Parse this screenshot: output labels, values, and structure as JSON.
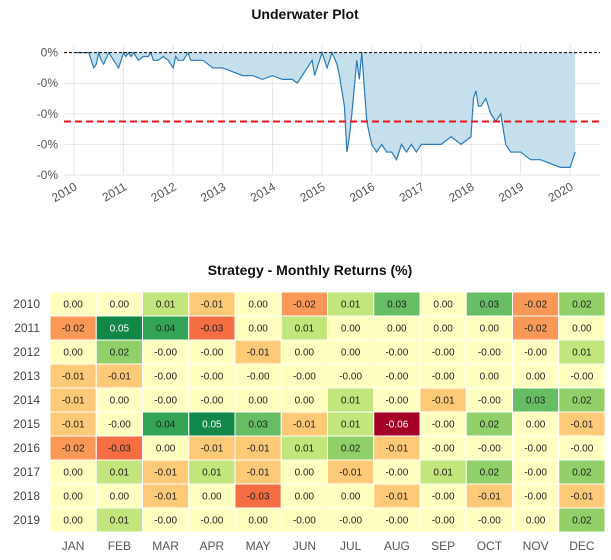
{
  "chart_data": [
    {
      "type": "area",
      "title": "Underwater Plot",
      "ytick_labels": [
        "0%",
        "-0%",
        "-0%",
        "-0%",
        "-0%"
      ],
      "xtick_labels": [
        "2010",
        "2011",
        "2012",
        "2013",
        "2014",
        "2015",
        "2016",
        "2017",
        "2018",
        "2019",
        "2020"
      ],
      "xlim": [
        2009.8,
        2020.6
      ],
      "ylim": [
        -0.0016,
        0.0001
      ],
      "reference_lines": [
        {
          "value": 0,
          "style": "dashed",
          "color": "#000000"
        },
        {
          "value": -0.0009,
          "style": "dashed",
          "color": "#e8141b"
        }
      ],
      "colors": {
        "fill": "#c6dfec",
        "line": "#2b7bba"
      },
      "grid": true,
      "series": [
        {
          "x": [
            2010.05,
            2010.3,
            2010.35,
            2010.4,
            2010.45,
            2010.5,
            2010.55,
            2010.6,
            2010.7,
            2010.8,
            2010.9,
            2010.95,
            2011.0,
            2011.05,
            2011.1,
            2011.15,
            2011.2,
            2011.3,
            2011.4,
            2011.5,
            2011.55,
            2011.6,
            2011.7,
            2011.8,
            2011.9,
            2012.0,
            2012.05,
            2012.1,
            2012.2,
            2012.3,
            2012.35,
            2012.45,
            2012.6,
            2012.8,
            2013.0,
            2013.2,
            2013.4,
            2013.6,
            2013.8,
            2014.0,
            2014.2,
            2014.4,
            2014.5,
            2014.6,
            2014.7,
            2014.8,
            2014.85,
            2014.9,
            2015.0,
            2015.1,
            2015.2,
            2015.3,
            2015.35,
            2015.4,
            2015.45,
            2015.5,
            2015.55,
            2015.6,
            2015.7,
            2015.75,
            2015.8,
            2015.9,
            2016.0,
            2016.1,
            2016.2,
            2016.3,
            2016.4,
            2016.5,
            2016.6,
            2016.7,
            2016.8,
            2016.9,
            2017.0,
            2017.2,
            2017.4,
            2017.6,
            2017.8,
            2018.0,
            2018.05,
            2018.1,
            2018.15,
            2018.2,
            2018.3,
            2018.4,
            2018.5,
            2018.6,
            2018.7,
            2018.8,
            2018.9,
            2019.0,
            2019.2,
            2019.4,
            2019.6,
            2019.8,
            2020.0,
            2020.05,
            2020.1
          ],
          "y": [
            0,
            0,
            -0.0001,
            -0.0002,
            -0.00015,
            0,
            -0.0001,
            -0.00015,
            0,
            -0.0001,
            -0.0002,
            -0.0001,
            0,
            -5e-05,
            0,
            -5e-05,
            0,
            -0.0001,
            -5e-05,
            -5e-05,
            0,
            -0.0001,
            -0.0001,
            -5e-05,
            -0.0001,
            -0.0002,
            -5e-05,
            -0.0001,
            -0.0001,
            0,
            -0.0001,
            -0.0001,
            -0.0001,
            -0.0002,
            -0.0002,
            -0.00025,
            -0.0003,
            -0.0003,
            -0.00035,
            -0.0003,
            -0.00035,
            -0.00035,
            -0.0004,
            -0.0003,
            -0.0002,
            -0.0001,
            -0.0003,
            -0.0002,
            0,
            -0.0002,
            0,
            -0.00015,
            -0.0003,
            -0.0005,
            -0.0007,
            -0.0013,
            -0.0011,
            -0.0008,
            -0.0001,
            -0.00035,
            0,
            -0.0009,
            -0.0012,
            -0.0013,
            -0.0012,
            -0.0013,
            -0.0013,
            -0.0014,
            -0.0012,
            -0.0013,
            -0.0012,
            -0.0013,
            -0.0012,
            -0.0012,
            -0.0012,
            -0.0011,
            -0.0012,
            -0.0011,
            -0.0006,
            -0.0005,
            -0.0007,
            -0.0007,
            -0.0006,
            -0.0008,
            -0.0009,
            -0.0008,
            -0.0012,
            -0.0013,
            -0.0013,
            -0.0013,
            -0.0014,
            -0.0014,
            -0.00145,
            -0.0015,
            -0.0015,
            -0.0014,
            -0.0013
          ]
        }
      ]
    },
    {
      "type": "heatmap",
      "title": "Strategy - Monthly Returns (%)",
      "columns": [
        "JAN",
        "FEB",
        "MAR",
        "APR",
        "MAY",
        "JUN",
        "JUL",
        "AUG",
        "SEP",
        "OCT",
        "NOV",
        "DEC"
      ],
      "rows": [
        "2010",
        "2011",
        "2012",
        "2013",
        "2014",
        "2015",
        "2016",
        "2017",
        "2018",
        "2019"
      ],
      "values": [
        [
          0.0,
          0.0,
          0.01,
          -0.01,
          0.0,
          -0.02,
          0.01,
          0.03,
          0.0,
          0.03,
          -0.02,
          0.02
        ],
        [
          -0.02,
          0.05,
          0.04,
          -0.03,
          0.0,
          0.01,
          0.0,
          0.0,
          0.0,
          0.0,
          -0.02,
          0.0
        ],
        [
          0.0,
          0.02,
          -0.0,
          -0.0,
          -0.01,
          0.0,
          0.0,
          -0.0,
          -0.0,
          -0.0,
          -0.0,
          0.01
        ],
        [
          -0.01,
          -0.01,
          -0.0,
          -0.0,
          -0.0,
          -0.0,
          -0.0,
          -0.0,
          -0.0,
          0.0,
          0.0,
          -0.0
        ],
        [
          -0.01,
          0.0,
          -0.0,
          -0.0,
          0.0,
          0.0,
          0.01,
          -0.0,
          -0.01,
          -0.0,
          0.03,
          0.02
        ],
        [
          -0.01,
          -0.0,
          0.04,
          0.05,
          0.03,
          -0.01,
          0.01,
          -0.06,
          -0.0,
          0.02,
          0.0,
          -0.01
        ],
        [
          -0.02,
          -0.03,
          0.0,
          -0.01,
          -0.01,
          0.01,
          0.02,
          -0.01,
          -0.0,
          -0.0,
          -0.0,
          -0.0
        ],
        [
          0.0,
          0.01,
          -0.01,
          0.01,
          -0.01,
          0.0,
          -0.01,
          -0.0,
          0.01,
          0.02,
          -0.0,
          0.02
        ],
        [
          0.0,
          0.0,
          -0.01,
          0.0,
          -0.03,
          0.0,
          0.0,
          -0.01,
          -0.0,
          -0.01,
          -0.0,
          -0.01
        ],
        [
          0.0,
          0.01,
          -0.0,
          -0.0,
          0.0,
          -0.0,
          -0.0,
          -0.0,
          -0.0,
          -0.0,
          0.0,
          0.02
        ]
      ],
      "labels": [
        [
          "0.00",
          "0.00",
          "0.01",
          "-0.01",
          "0.00",
          "-0.02",
          "0.01",
          "0.03",
          "0.00",
          "0.03",
          "-0.02",
          "0.02"
        ],
        [
          "-0.02",
          "0.05",
          "0.04",
          "-0.03",
          "0.00",
          "0.01",
          "0.00",
          "0.00",
          "0.00",
          "0.00",
          "-0.02",
          "0.00"
        ],
        [
          "0.00",
          "0.02",
          "-0.00",
          "-0.00",
          "-0.01",
          "0.00",
          "0.00",
          "-0.00",
          "-0.00",
          "-0.00",
          "-0.00",
          "0.01"
        ],
        [
          "-0.01",
          "-0.01",
          "-0.00",
          "-0.00",
          "-0.00",
          "-0.00",
          "-0.00",
          "-0.00",
          "-0.00",
          "0.00",
          "0.00",
          "-0.00"
        ],
        [
          "-0.01",
          "0.00",
          "-0.00",
          "-0.00",
          "0.00",
          "0.00",
          "0.01",
          "-0.00",
          "-0.01",
          "-0.00",
          "0.03",
          "0.02"
        ],
        [
          "-0.01",
          "-0.00",
          "0.04",
          "0.05",
          "0.03",
          "-0.01",
          "0.01",
          "-0.06",
          "-0.00",
          "0.02",
          "0.00",
          "-0.01"
        ],
        [
          "-0.02",
          "-0.03",
          "0.00",
          "-0.01",
          "-0.01",
          "0.01",
          "0.02",
          "-0.01",
          "-0.00",
          "-0.00",
          "-0.00",
          "-0.00"
        ],
        [
          "0.00",
          "0.01",
          "-0.01",
          "0.01",
          "-0.01",
          "0.00",
          "-0.01",
          "-0.00",
          "0.01",
          "0.02",
          "-0.00",
          "0.02"
        ],
        [
          "0.00",
          "0.00",
          "-0.01",
          "0.00",
          "-0.03",
          "0.00",
          "0.00",
          "-0.01",
          "-0.00",
          "-0.01",
          "-0.00",
          "-0.01"
        ],
        [
          "0.00",
          "0.01",
          "-0.00",
          "-0.00",
          "0.00",
          "-0.00",
          "-0.00",
          "-0.00",
          "-0.00",
          "-0.00",
          "0.00",
          "0.02"
        ]
      ],
      "colormap": "RdYlGn",
      "vmin": -0.06,
      "vmax": 0.06
    }
  ]
}
